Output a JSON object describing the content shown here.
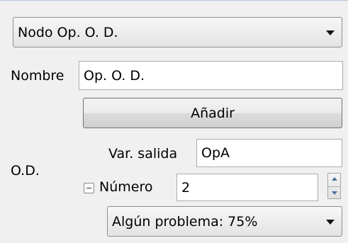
{
  "node_type_select": {
    "value": "Nodo Op. O. D."
  },
  "name_row": {
    "label": "Nombre",
    "value": "Op. O. D."
  },
  "add_button": {
    "label": "Añadir"
  },
  "od_section": {
    "label": "O.D.",
    "output_var": {
      "label": "Var. salida",
      "value": "OpA"
    },
    "number": {
      "label": "Número",
      "value": "2"
    },
    "problem_select": {
      "value": "Algún problema: 75%"
    }
  },
  "icons": [
    "chevron-down-icon",
    "collapse-icon",
    "spin-up-icon",
    "spin-down-icon"
  ]
}
